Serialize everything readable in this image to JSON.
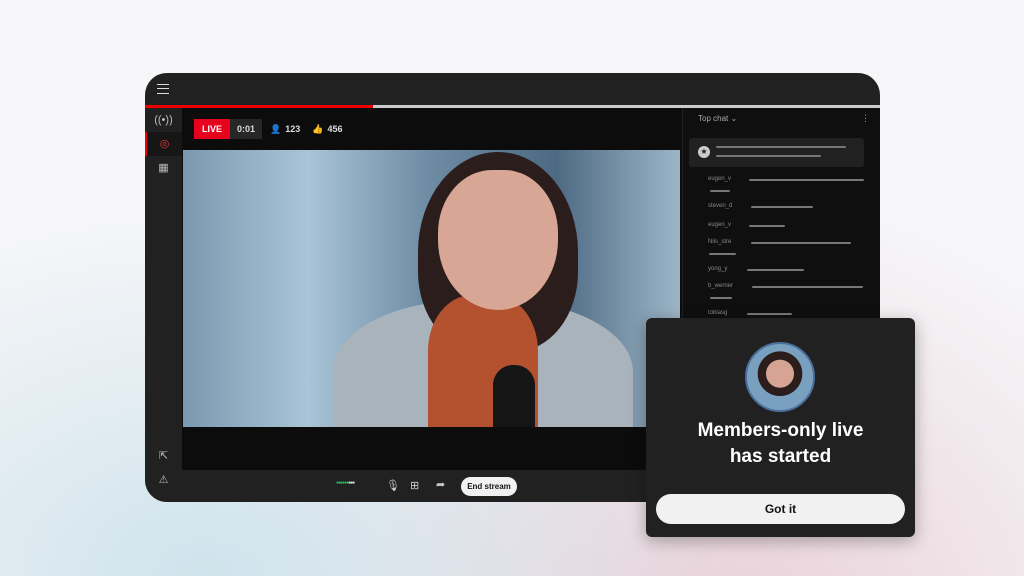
{
  "stats": {
    "live_label": "LIVE",
    "elapsed": "0:01",
    "viewers": "123",
    "likes": "456"
  },
  "chat": {
    "header": "Top chat",
    "messages": [
      {
        "user": "eugen_v"
      },
      {
        "user": "steven_d"
      },
      {
        "user": "eugen_v"
      },
      {
        "user": "Nils_stre"
      },
      {
        "user": "yong_y"
      },
      {
        "user": "b_werner"
      },
      {
        "user": "tobiasg"
      }
    ]
  },
  "controls": {
    "end_stream": "End stream"
  },
  "popup": {
    "title_line1": "Members-only live",
    "title_line2": "has started",
    "button": "Got it"
  },
  "colors": {
    "accent": "#e8001f",
    "level": "#1db954"
  },
  "progress": 0.31
}
